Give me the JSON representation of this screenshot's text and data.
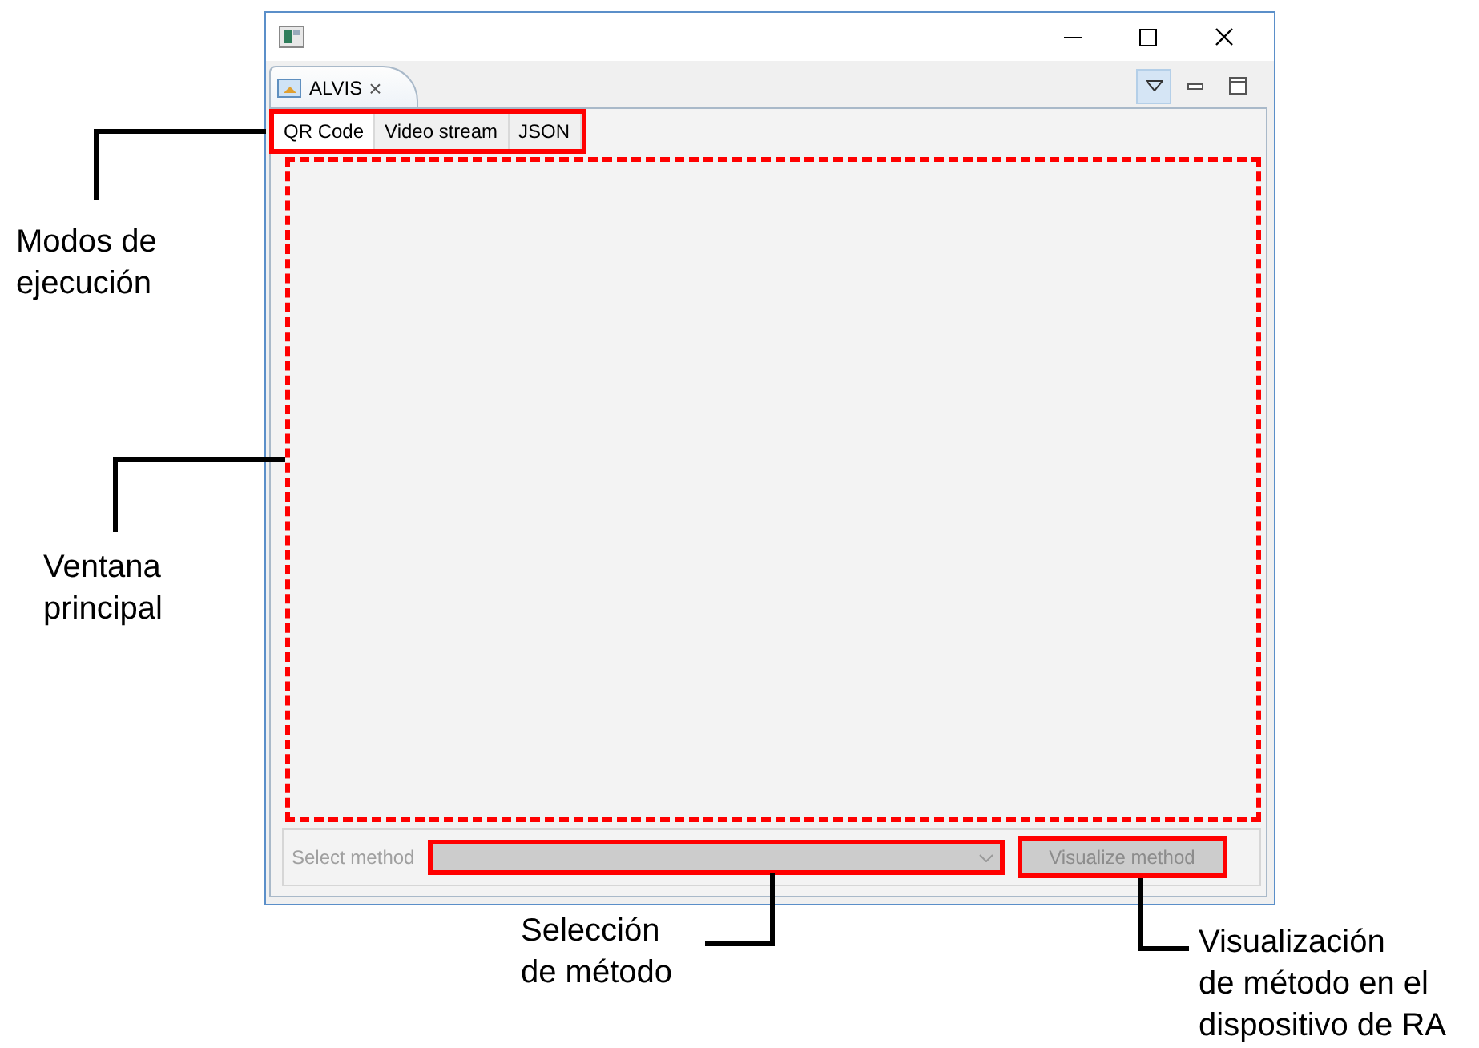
{
  "window": {
    "view_tab": {
      "label": "ALVIS",
      "close": "×"
    }
  },
  "mode_tabs": [
    {
      "label": "QR Code",
      "selected": true
    },
    {
      "label": "Video stream",
      "selected": false
    },
    {
      "label": "JSON",
      "selected": false
    }
  ],
  "method_bar": {
    "label": "Select method",
    "disabled": true,
    "button": "Visualize method"
  },
  "annotations": [
    {
      "text": "Modos de\nejecución"
    },
    {
      "text": "Ventana\nprincipal"
    },
    {
      "text": "Selección\nde método"
    },
    {
      "text": "Visualización\nde método en el\ndispositivo de RA"
    }
  ]
}
